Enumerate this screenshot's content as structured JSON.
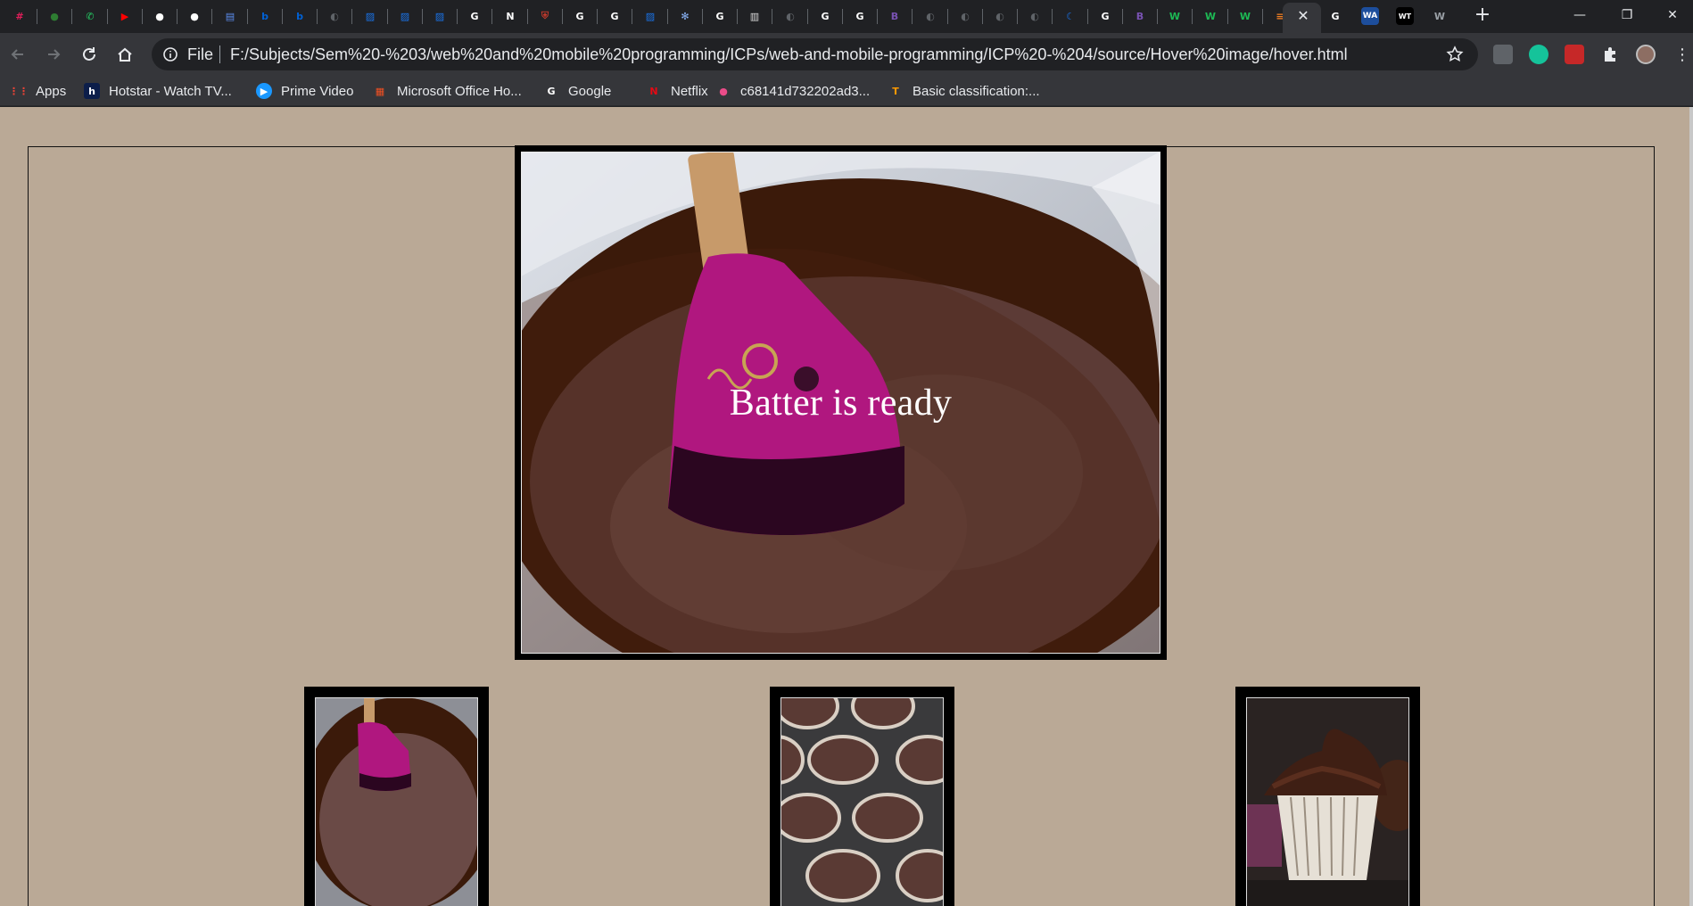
{
  "browser": {
    "active_tab_close": "✕",
    "new_tab": "+",
    "window_controls": {
      "minimize": "—",
      "maximize": "❐",
      "close": "✕"
    },
    "tab_favicons": [
      {
        "icon": "slack-icon",
        "color": "#e01e5a",
        "glyph": "#"
      },
      {
        "icon": "green-circle-icon",
        "color": "#2e7d32",
        "glyph": "●"
      },
      {
        "icon": "whatsapp-icon",
        "color": "#25d366",
        "glyph": "✆"
      },
      {
        "icon": "youtube-icon",
        "color": "#ff0000",
        "glyph": "▶"
      },
      {
        "icon": "github-icon",
        "color": "#ffffff",
        "glyph": "●"
      },
      {
        "icon": "github-icon",
        "color": "#ffffff",
        "glyph": "●"
      },
      {
        "icon": "doc-icon",
        "color": "#5b8def",
        "glyph": "▤"
      },
      {
        "icon": "box-icon",
        "color": "#0061d5",
        "glyph": "b"
      },
      {
        "icon": "box-icon",
        "color": "#0061d5",
        "glyph": "b"
      },
      {
        "icon": "globe-icon",
        "color": "#5f6368",
        "glyph": "◐"
      },
      {
        "icon": "blue-stripe-icon",
        "color": "#1a73e8",
        "glyph": "▨"
      },
      {
        "icon": "blue-stripe-icon",
        "color": "#1a73e8",
        "glyph": "▨"
      },
      {
        "icon": "blue-stripe-icon",
        "color": "#1a73e8",
        "glyph": "▨"
      },
      {
        "icon": "google-icon",
        "color": "#ffffff",
        "glyph": "G"
      },
      {
        "icon": "notion-icon",
        "color": "#ffffff",
        "glyph": "N"
      },
      {
        "icon": "shield-icon",
        "color": "#c0392b",
        "glyph": "⛨"
      },
      {
        "icon": "google-icon",
        "color": "#ffffff",
        "glyph": "G"
      },
      {
        "icon": "google-icon",
        "color": "#ffffff",
        "glyph": "G"
      },
      {
        "icon": "blue-stripe-icon",
        "color": "#1a73e8",
        "glyph": "▨"
      },
      {
        "icon": "gear-icon",
        "color": "#8ab4f8",
        "glyph": "✻"
      },
      {
        "icon": "google-icon",
        "color": "#ffffff",
        "glyph": "G"
      },
      {
        "icon": "doc-icon",
        "color": "#dddddd",
        "glyph": "▥"
      },
      {
        "icon": "globe-icon",
        "color": "#5f6368",
        "glyph": "◐"
      },
      {
        "icon": "google-icon",
        "color": "#ffffff",
        "glyph": "G"
      },
      {
        "icon": "google-icon",
        "color": "#ffffff",
        "glyph": "G"
      },
      {
        "icon": "bootstrap-icon",
        "color": "#7952b3",
        "glyph": "B"
      },
      {
        "icon": "globe-icon",
        "color": "#5f6368",
        "glyph": "◐"
      },
      {
        "icon": "globe-icon",
        "color": "#5f6368",
        "glyph": "◐"
      },
      {
        "icon": "globe-icon",
        "color": "#5f6368",
        "glyph": "◐"
      },
      {
        "icon": "globe-icon",
        "color": "#5f6368",
        "glyph": "◐"
      },
      {
        "icon": "moon-icon",
        "color": "#1a73e8",
        "glyph": "☾"
      },
      {
        "icon": "google-icon",
        "color": "#ffffff",
        "glyph": "G"
      },
      {
        "icon": "bootstrap-icon",
        "color": "#7952b3",
        "glyph": "B"
      },
      {
        "icon": "w-icon",
        "color": "#1db954",
        "glyph": "W"
      },
      {
        "icon": "w-icon",
        "color": "#1db954",
        "glyph": "W"
      },
      {
        "icon": "w-icon",
        "color": "#1db954",
        "glyph": "W"
      },
      {
        "icon": "stack-overflow-icon",
        "color": "#f48024",
        "glyph": "≡"
      }
    ],
    "tab_favicons_right": [
      {
        "icon": "google-icon",
        "color": "#ffffff",
        "glyph": "G"
      },
      {
        "icon": "wa-icon",
        "color": "#1d4e9c",
        "glyph": "WA"
      },
      {
        "icon": "wt-icon",
        "color": "#000000",
        "glyph": "WT"
      },
      {
        "icon": "w-icon",
        "color": "#9aa0a6",
        "glyph": "W"
      }
    ]
  },
  "toolbar": {
    "file_label": "File",
    "url": "F:/Subjects/Sem%20-%203/web%20and%20mobile%20programming/ICPs/web-and-mobile-programming/ICP%20-%204/source/Hover%20image/hover.html"
  },
  "bookmarks": [
    {
      "label": "Apps",
      "icon": "apps-grid-icon",
      "color": "#ea4335",
      "glyph": "⋮⋮"
    },
    {
      "label": "Hotstar - Watch TV...",
      "icon": "hotstar-icon",
      "color": "#0c1e4a",
      "glyph": "h"
    },
    {
      "label": "Prime Video",
      "icon": "prime-video-icon",
      "color": "#1a98ff",
      "glyph": "▶"
    },
    {
      "label": "Microsoft Office Ho...",
      "icon": "microsoft-icon",
      "color": "#f25022",
      "glyph": "▦"
    },
    {
      "label": "Google",
      "icon": "google-icon",
      "color": "#ffffff",
      "glyph": "G"
    },
    {
      "label": "Netflix",
      "icon": "netflix-icon",
      "color": "#e50914",
      "glyph": "N"
    },
    {
      "label": "c68141d732202ad3...",
      "icon": "dribbble-icon",
      "color": "#ea4c89",
      "glyph": "●"
    },
    {
      "label": "Basic classification:...",
      "icon": "tensorflow-icon",
      "color": "#ff9800",
      "glyph": "T"
    }
  ],
  "page": {
    "main_caption": "Batter is ready",
    "colors": {
      "background": "#baa996",
      "frame": "#000000"
    }
  }
}
